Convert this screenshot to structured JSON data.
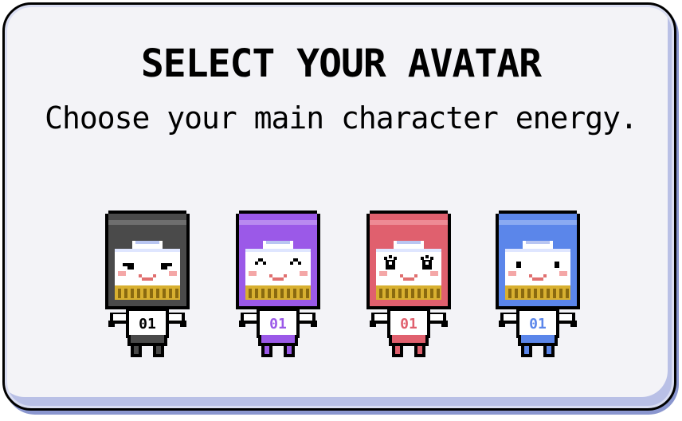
{
  "screen": {
    "title": "SELECT YOUR AVATAR",
    "subtitle": "Choose your main character energy."
  },
  "avatars": [
    {
      "id": "gray",
      "jersey_number": "01",
      "hair_color": "#4a4a4a",
      "hair_light": "#6e6e6e",
      "eyes": "smirk"
    },
    {
      "id": "purple",
      "jersey_number": "01",
      "hair_color": "#9b59e8",
      "hair_light": "#b98af0",
      "eyes": "happy"
    },
    {
      "id": "red",
      "jersey_number": "01",
      "hair_color": "#e0606e",
      "hair_light": "#ee8a94",
      "eyes": "lashes"
    },
    {
      "id": "blue",
      "jersey_number": "01",
      "hair_color": "#5b86ea",
      "hair_light": "#8aaaf2",
      "eyes": "dots"
    }
  ],
  "colors": {
    "panel_bg": "#f3f3f7",
    "panel_shadow": "#8a96cf",
    "skin": "#ffffff",
    "blush": "#f4a7a7",
    "mouth": "#e07070",
    "beard": "#d8b030"
  }
}
